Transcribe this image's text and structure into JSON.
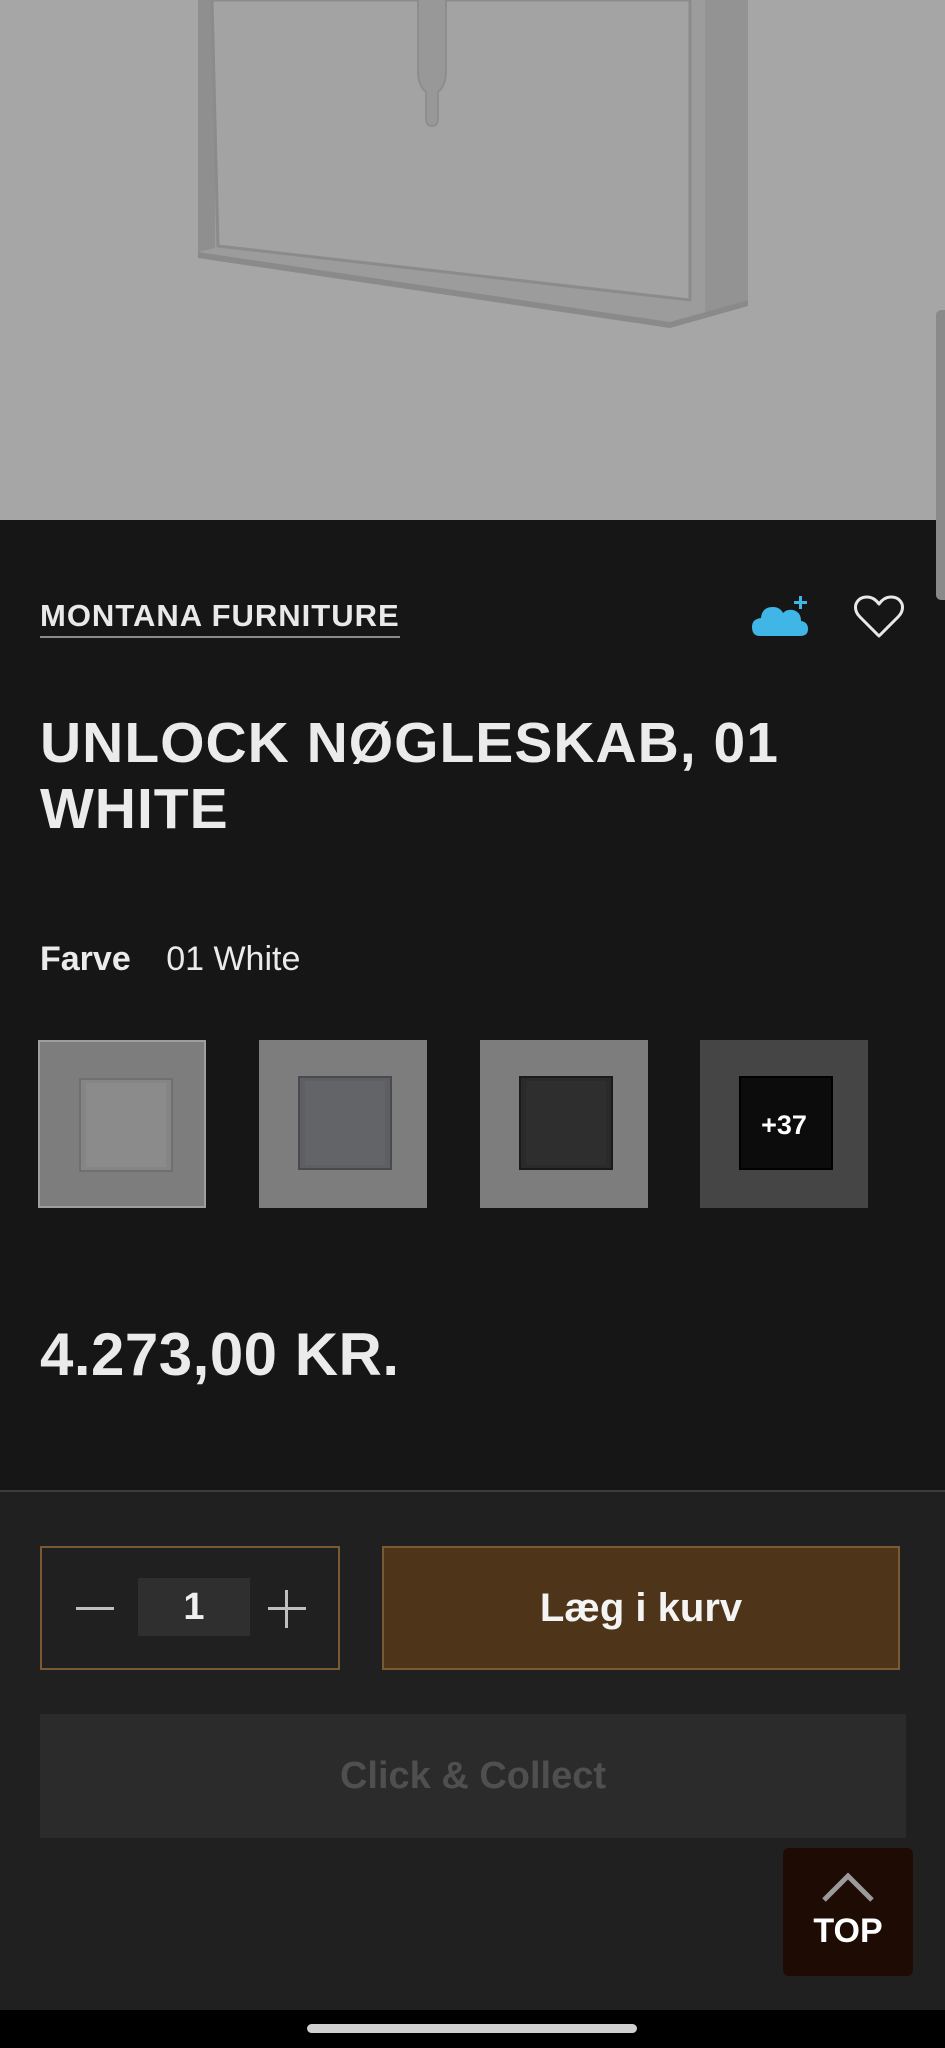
{
  "product": {
    "brand": "MONTANA FURNITURE",
    "title": "UNLOCK NØGLESKAB, 01 WHITE",
    "color_label": "Farve",
    "color_value": "01 White",
    "more_colors_label": "+37",
    "price": "4.273,00 KR."
  },
  "icons": {
    "cloud": "cloud-plus-icon",
    "heart": "heart-icon",
    "minus": "minus-icon",
    "plus": "plus-icon",
    "top": "chevron-up-icon"
  },
  "purchase": {
    "quantity": "1",
    "add_to_cart_label": "Læg i kurv",
    "click_collect_label": "Click & Collect",
    "top_label": "TOP"
  },
  "colors": {
    "background": "#161616",
    "purchase_bg": "#202020",
    "accent_brown": "#4e3418",
    "accent_border": "#7a5a34",
    "cloud_blue": "#3fb6e6"
  }
}
